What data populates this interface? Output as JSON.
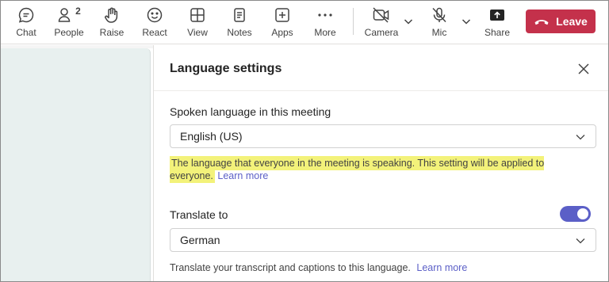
{
  "toolbar": {
    "chat": "Chat",
    "people": "People",
    "people_count": "2",
    "raise": "Raise",
    "react": "React",
    "view": "View",
    "notes": "Notes",
    "apps": "Apps",
    "more": "More",
    "camera": "Camera",
    "mic": "Mic",
    "share": "Share",
    "leave": "Leave"
  },
  "panel": {
    "title": "Language settings",
    "spoken": {
      "label": "Spoken language in this meeting",
      "value": "English (US)",
      "help": "The language that everyone in the meeting is speaking. This setting will be applied to everyone.",
      "link": "Learn more"
    },
    "translate": {
      "label": "Translate to",
      "enabled": true,
      "value": "German",
      "help": "Translate your transcript and captions to this language.",
      "link": "Learn more"
    }
  },
  "colors": {
    "leave": "#c4314b",
    "accent": "#5b5fc7",
    "highlight": "#f3f27a"
  },
  "icons": [
    "chat-icon",
    "people-icon",
    "raise-hand-icon",
    "react-icon",
    "view-icon",
    "notes-icon",
    "apps-icon",
    "more-icon",
    "camera-off-icon",
    "mic-off-icon",
    "share-icon",
    "phone-hangup-icon",
    "close-icon",
    "chevron-down-icon"
  ]
}
